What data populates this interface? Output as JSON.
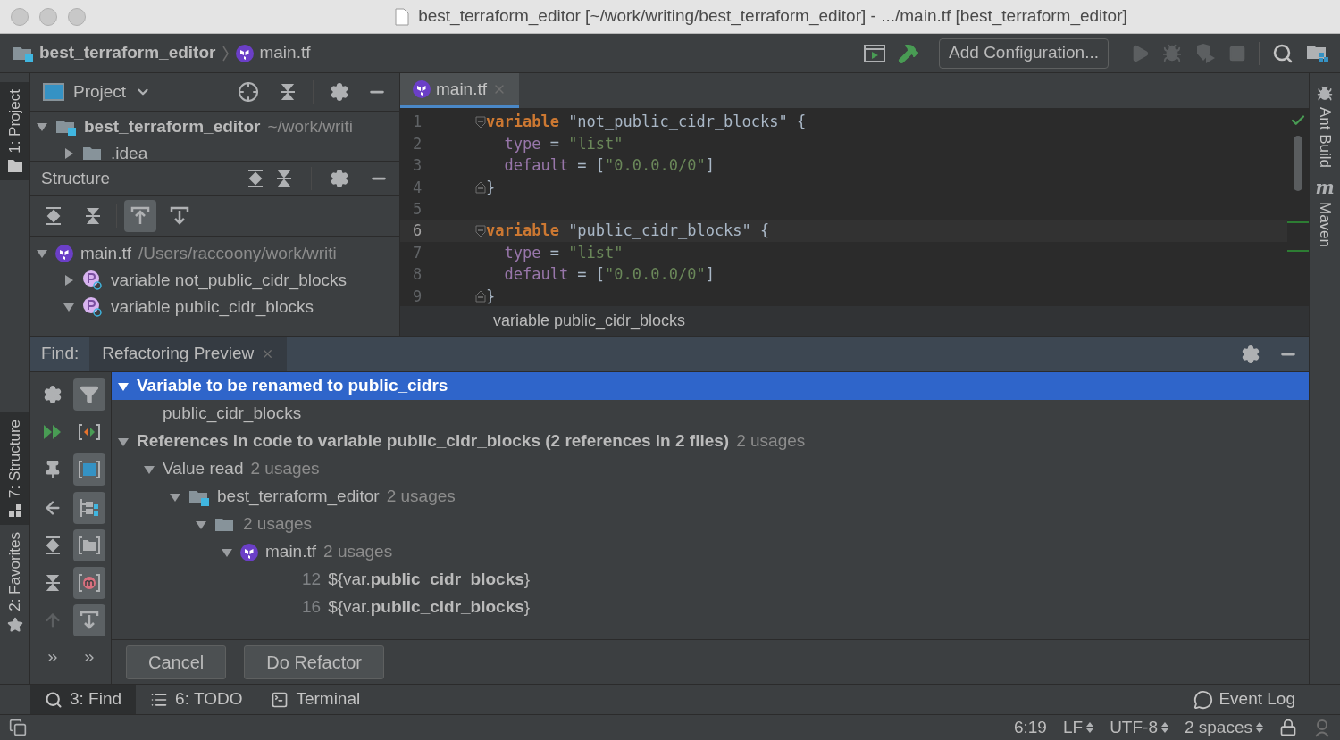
{
  "window": {
    "title": "best_terraform_editor [~/work/writing/best_terraform_editor] - .../main.tf [best_terraform_editor]"
  },
  "breadcrumb": [
    {
      "label": "best_terraform_editor",
      "kind": "project"
    },
    {
      "label": "main.tf",
      "kind": "terraform"
    }
  ],
  "toolbar": {
    "configuration": "Add Configuration..."
  },
  "left_stripe": [
    {
      "label": "1: Project",
      "kind": "project",
      "selected": true
    },
    {
      "label": "7: Structure",
      "kind": "structure",
      "selected": true
    },
    {
      "label": "2: Favorites",
      "kind": "favorites",
      "selected": false
    }
  ],
  "right_stripe": [
    {
      "label": "Ant Build",
      "kind": "ant"
    },
    {
      "label": "Maven",
      "kind": "maven",
      "icon": "m"
    }
  ],
  "project_panel": {
    "title": "Project",
    "tree": [
      {
        "label": "best_terraform_editor",
        "path": "~/work/writi",
        "kind": "project",
        "expanded": true,
        "children": [
          {
            "label": ".idea",
            "kind": "folder",
            "expanded": false
          }
        ]
      }
    ]
  },
  "structure_panel": {
    "title": "Structure",
    "tools": [
      {
        "kind": "expand",
        "selected": false
      },
      {
        "kind": "collapse",
        "selected": false
      },
      {
        "kind": "scroll_from",
        "selected": true
      },
      {
        "kind": "scroll_to",
        "selected": false
      }
    ],
    "tree": [
      {
        "label": "main.tf",
        "path": "/Users/raccoony/work/writi",
        "kind": "terraform",
        "expanded": true,
        "children": [
          {
            "label": "variable not_public_cidr_blocks",
            "kind": "property",
            "expanded": false
          },
          {
            "label": "variable public_cidr_blocks",
            "kind": "property",
            "expanded": true
          }
        ]
      }
    ]
  },
  "editor": {
    "tabs": [
      {
        "label": "main.tf",
        "selected": true
      }
    ],
    "lines": [
      {
        "number": "1",
        "current": false,
        "indent": false,
        "fold_start": true,
        "fold_end": false,
        "tokens": [
          {
            "kind": "keyword",
            "text": "variable"
          },
          {
            "kind": "label",
            "text": "\"not_public_cidr_blocks\""
          },
          {
            "kind": "plain",
            "text": " {"
          }
        ]
      },
      {
        "number": "2",
        "current": false,
        "indent": true,
        "fold_start": false,
        "fold_end": false,
        "tokens": [
          {
            "kind": "property",
            "text": "type"
          },
          {
            "kind": "plain",
            "text": " = "
          },
          {
            "kind": "string",
            "text": "\"list\""
          }
        ]
      },
      {
        "number": "3",
        "current": false,
        "indent": true,
        "fold_start": false,
        "fold_end": false,
        "tokens": [
          {
            "kind": "property",
            "text": "default"
          },
          {
            "kind": "plain",
            "text": " = ["
          },
          {
            "kind": "string",
            "text": "\"0.0.0.0/0\""
          },
          {
            "kind": "plain",
            "text": "]"
          }
        ]
      },
      {
        "number": "4",
        "current": false,
        "indent": false,
        "fold_start": false,
        "fold_end": true,
        "tokens": [
          {
            "kind": "plain",
            "text": "}"
          }
        ]
      },
      {
        "number": "5",
        "current": false,
        "fold_start": false,
        "fold_end": false
      },
      {
        "number": "6",
        "current": true,
        "indent": false,
        "fold_start": true,
        "fold_end": false,
        "tokens": [
          {
            "kind": "keyword",
            "text": "variable"
          },
          {
            "kind": "label",
            "text": "\"public_cidr_blocks\""
          },
          {
            "kind": "plain",
            "text": " {"
          }
        ]
      },
      {
        "number": "7",
        "current": false,
        "indent": true,
        "fold_start": false,
        "fold_end": false,
        "tokens": [
          {
            "kind": "property",
            "text": "type"
          },
          {
            "kind": "plain",
            "text": " = "
          },
          {
            "kind": "string",
            "text": "\"list\""
          }
        ]
      },
      {
        "number": "8",
        "current": false,
        "indent": true,
        "fold_start": false,
        "fold_end": false,
        "tokens": [
          {
            "kind": "property",
            "text": "default"
          },
          {
            "kind": "plain",
            "text": " = ["
          },
          {
            "kind": "string",
            "text": "\"0.0.0.0/0\""
          },
          {
            "kind": "plain",
            "text": "]"
          }
        ]
      },
      {
        "number": "9",
        "current": false,
        "indent": false,
        "fold_start": false,
        "fold_end": true,
        "tokens": [
          {
            "kind": "plain",
            "text": "}"
          }
        ]
      }
    ],
    "breadcrumb": "variable public_cidr_blocks"
  },
  "find_panel": {
    "label": "Find:",
    "tabs": [
      {
        "label": "Refactoring Preview",
        "selected": true
      }
    ],
    "tools": [
      {
        "kind": "settings",
        "selected": false
      },
      {
        "kind": "filter",
        "selected": true
      },
      {
        "kind": "rerun",
        "selected": false
      },
      {
        "kind": "merge",
        "selected": false
      },
      {
        "kind": "pin",
        "selected": false
      },
      {
        "kind": "preview",
        "selected": true
      },
      {
        "kind": "back",
        "selected": false
      },
      {
        "kind": "group",
        "selected": true
      },
      {
        "kind": "expand",
        "selected": false
      },
      {
        "kind": "module",
        "selected": true
      },
      {
        "kind": "collapse",
        "selected": false
      },
      {
        "kind": "method",
        "selected": true
      },
      {
        "kind": "up",
        "selected": false
      },
      {
        "kind": "autoscroll",
        "selected": true
      },
      {
        "kind": "more",
        "selected": false
      },
      {
        "kind": "more",
        "selected": false
      }
    ],
    "tree": [
      {
        "label": "Variable to be renamed to public_cidrs",
        "kind": "heading",
        "selected": true,
        "expanded": true,
        "children": [
          {
            "label": "public_cidr_blocks",
            "selected": false
          }
        ]
      },
      {
        "label": "References in code to variable public_cidr_blocks (2 references in 2 files)",
        "count": "2 usages",
        "kind": "heading",
        "selected": false,
        "expanded": true,
        "children": [
          {
            "label": "Value read",
            "count": "2 usages",
            "selected": false,
            "expanded": true,
            "children": [
              {
                "label": "best_terraform_editor",
                "count": "2 usages",
                "kind": "project",
                "selected": false,
                "expanded": true,
                "children": [
                  {
                    "count": "2 usages",
                    "kind": "folder",
                    "selected": false,
                    "expanded": true,
                    "children": [
                      {
                        "label": "main.tf",
                        "count": "2 usages",
                        "kind": "terraform",
                        "selected": false,
                        "expanded": true,
                        "children": [
                          {
                            "line": "12",
                            "label": "${var.**public_cidr_blocks**}",
                            "selected": false
                          },
                          {
                            "line": "16",
                            "label": "${var.**public_cidr_blocks**}",
                            "selected": false
                          }
                        ]
                      }
                    ]
                  }
                ]
              }
            ]
          }
        ]
      }
    ],
    "buttons": [
      "Cancel",
      "Do Refactor"
    ]
  },
  "tool_windows": [
    {
      "label": "3: Find",
      "kind": "find",
      "selected": true
    },
    {
      "label": "6: TODO",
      "kind": "todo",
      "selected": false
    },
    {
      "label": "Terminal",
      "kind": "terminal",
      "selected": false
    }
  ],
  "event_log": "Event Log",
  "status_bar": [
    {
      "label": "6:19",
      "kind": "plain"
    },
    {
      "label": "LF",
      "kind": "dropdown"
    },
    {
      "label": "UTF-8",
      "kind": "dropdown"
    },
    {
      "label": "2 spaces",
      "kind": "dropdown"
    }
  ]
}
